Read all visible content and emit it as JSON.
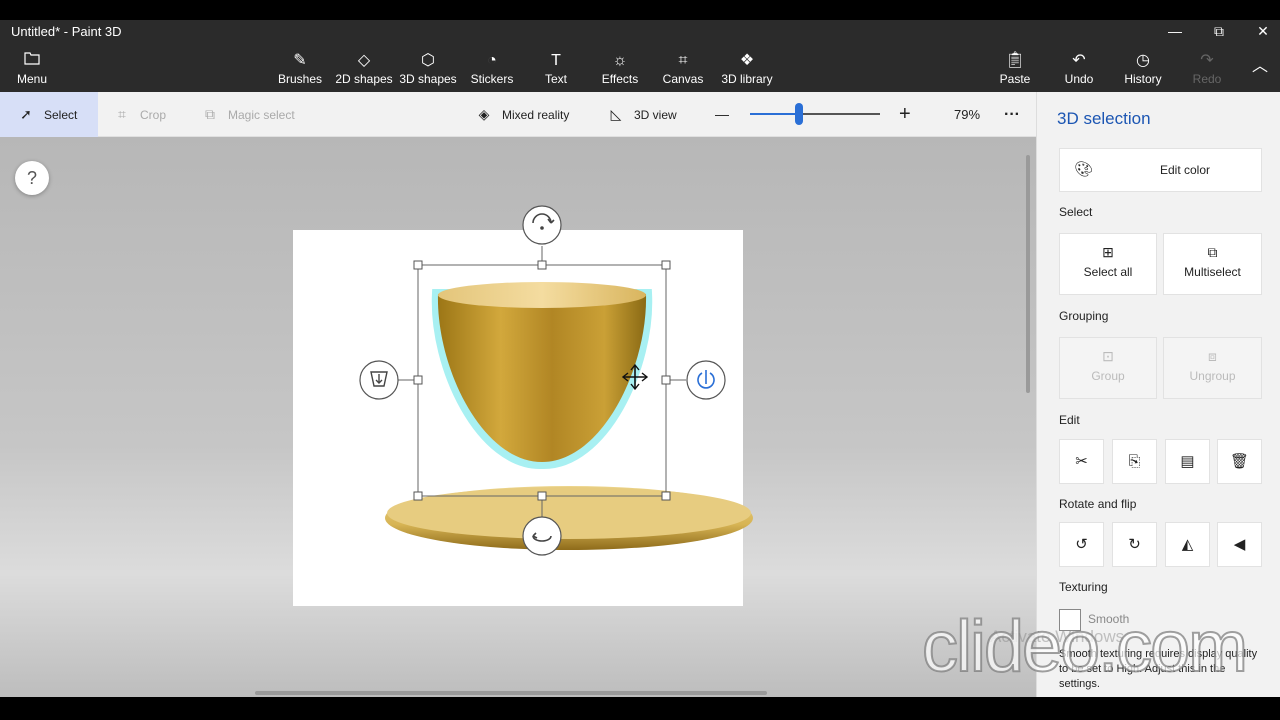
{
  "window": {
    "title": "Untitled* - Paint 3D",
    "minimize": "—",
    "maximize": "⧉",
    "close": "✕"
  },
  "ribbon": {
    "menu": {
      "label": "Menu",
      "icon": "folder-icon"
    },
    "tools": [
      {
        "label": "Brushes",
        "icon": "brush-icon"
      },
      {
        "label": "2D shapes",
        "icon": "2d-shapes-icon"
      },
      {
        "label": "3D shapes",
        "icon": "3d-shapes-icon"
      },
      {
        "label": "Stickers",
        "icon": "stickers-icon"
      },
      {
        "label": "Text",
        "icon": "text-icon"
      },
      {
        "label": "Effects",
        "icon": "effects-icon"
      },
      {
        "label": "Canvas",
        "icon": "canvas-icon"
      },
      {
        "label": "3D library",
        "icon": "3d-library-icon"
      }
    ],
    "paste": "Paste",
    "undo": "Undo",
    "history": "History",
    "redo": "Redo"
  },
  "toolbar": {
    "select": "Select",
    "crop": "Crop",
    "magic_select": "Magic select",
    "mixed_reality": "Mixed reality",
    "view_3d": "3D view",
    "zoom_minus": "—",
    "zoom_plus": "+",
    "zoom_level": "79%",
    "zoom_fraction": 0.38,
    "more": "···"
  },
  "workspace": {
    "help": "?"
  },
  "panel": {
    "title": "3D selection",
    "edit_color": "Edit color",
    "select_heading": "Select",
    "select_all": "Select all",
    "multiselect": "Multiselect",
    "grouping_heading": "Grouping",
    "group": "Group",
    "ungroup": "Ungroup",
    "edit_heading": "Edit",
    "edit_icons": [
      "cut-icon",
      "copy-icon",
      "paste-icon",
      "delete-icon"
    ],
    "rotate_heading": "Rotate and flip",
    "rotate_icons": [
      "rotate-left-icon",
      "rotate-right-icon",
      "flip-horizontal-icon",
      "flip-vertical-icon"
    ],
    "texturing_heading": "Texturing",
    "smooth": "Smooth",
    "smooth_note": "Smooth texturing requires display quality to be set to High. Adjust this in the settings."
  },
  "overlay": {
    "activate": "Activate Windows",
    "watermark": "clideo.com"
  },
  "colors": {
    "accent": "#2a6fd6",
    "gold": "#c9a033",
    "selection_glow": "#a8f0f2",
    "chrome": "#2b2b2b"
  }
}
